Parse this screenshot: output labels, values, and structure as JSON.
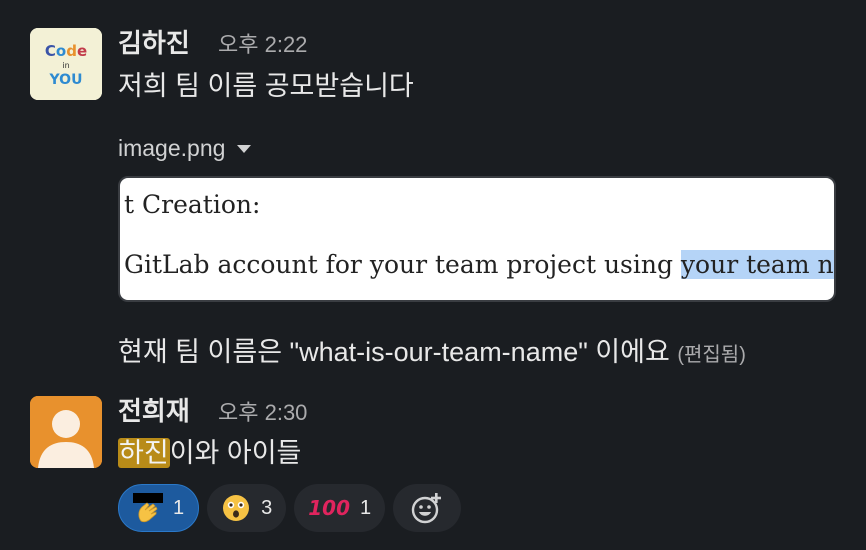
{
  "messages": [
    {
      "author": "김하진",
      "time": "오후 2:22",
      "text": "저희 팀 이름 공모받습니다",
      "attachment": {
        "filename": "image.png",
        "preview_lines": [
          "t Creation:",
          "GitLab account for your team project using ",
          "your team n"
        ]
      },
      "followup_text": "현재 팀 이름은 \"what-is-our-team-name\" 이에요",
      "edited_label": "(편집됨)"
    },
    {
      "author": "전희재",
      "time": "오후 2:30",
      "mention": "하진",
      "text_after_mention": "이와 아이들",
      "reactions": [
        {
          "emoji": "clapping-hand-emoji",
          "count": "1",
          "active": true
        },
        {
          "emoji": "😲",
          "count": "3",
          "active": false
        },
        {
          "emoji": "💯",
          "count": "1",
          "active": false
        }
      ]
    }
  ],
  "avatar_logo_text": {
    "line1": "Code",
    "line2": "in",
    "line3": "YOU"
  },
  "colors": {
    "background": "#1a1d21",
    "mention_highlight": "#b88b18",
    "active_reaction": "#1d5a9e",
    "avatar_orange": "#e8912d"
  }
}
